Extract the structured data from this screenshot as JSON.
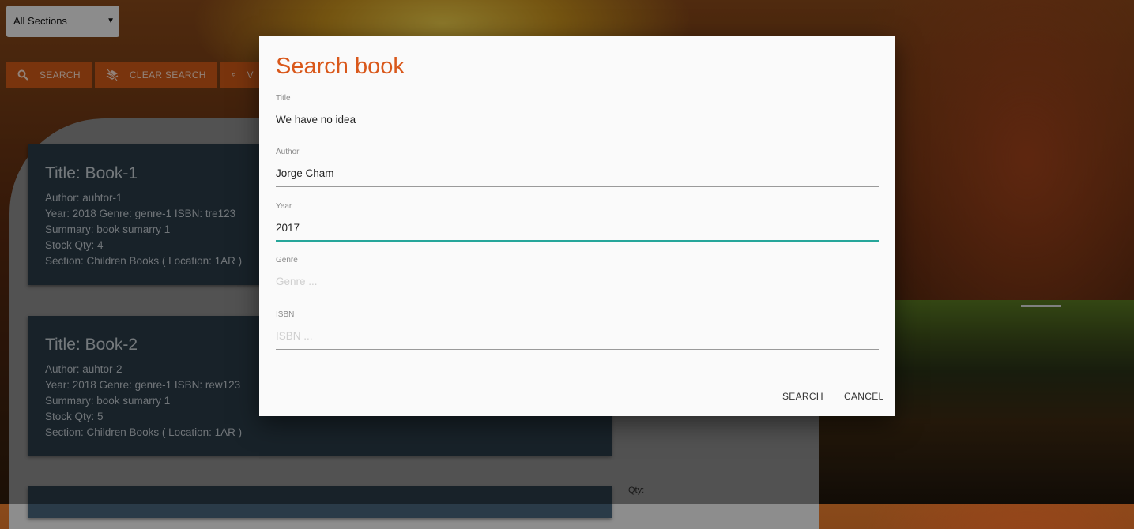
{
  "section_select": {
    "value": "All Sections"
  },
  "toolbar": {
    "search_label": "SEARCH",
    "clear_label": "CLEAR SEARCH",
    "cart_label": "V"
  },
  "books": [
    {
      "title": "Title: Book-1",
      "author": "Author: auhtor-1",
      "details": "Year: 2018 Genre: genre-1 ISBN: tre123",
      "summary": "Summary: book sumarry 1",
      "stock": "Stock Qty: 4",
      "section": "Section: Children Books ( Location: 1AR )"
    },
    {
      "title": "Title: Book-2",
      "author": "Author: auhtor-2",
      "details": "Year: 2018 Genre: genre-1 ISBN: rew123",
      "summary": "Summary: book sumarry 1",
      "stock": "Stock Qty: 5",
      "section": "Section: Children Books ( Location: 1AR )"
    }
  ],
  "qty_label": "Qty:",
  "dialog": {
    "title": "Search book",
    "fields": {
      "title": {
        "label": "Title",
        "value": "We have no idea",
        "placeholder": ""
      },
      "author": {
        "label": "Author",
        "value": "Jorge Cham",
        "placeholder": ""
      },
      "year": {
        "label": "Year",
        "value": "2017",
        "placeholder": ""
      },
      "genre": {
        "label": "Genre",
        "value": "",
        "placeholder": "Genre ..."
      },
      "isbn": {
        "label": "ISBN",
        "value": "",
        "placeholder": "ISBN ..."
      }
    },
    "search_button": "SEARCH",
    "cancel_button": "CANCEL"
  },
  "colors": {
    "accent": "#d9581b",
    "toolbar_button": "#d15a17",
    "active_underline": "#26a69a",
    "card_bg": "#2a3b48"
  }
}
